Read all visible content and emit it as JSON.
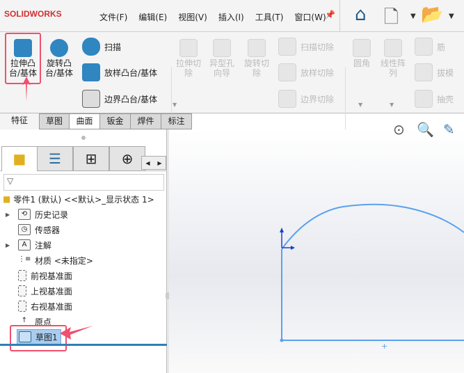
{
  "app": {
    "logo": "SOLIDWORKS"
  },
  "menu": [
    "文件(F)",
    "编辑(E)",
    "视图(V)",
    "插入(I)",
    "工具(T)",
    "窗口(W)"
  ],
  "ribbon": {
    "extrude_boss": "拉伸凸\n台/基体",
    "revolve_boss": "旋转凸\n台/基体",
    "sweep": "扫描",
    "loft": "放样凸台/基体",
    "boundary": "边界凸台/基体",
    "extrude_cut": "拉伸切\n除",
    "hole_wizard": "异型孔\n向导",
    "revolve_cut": "旋转切\n除",
    "sweep_cut": "扫描切除",
    "loft_cut": "放样切除",
    "boundary_cut": "边界切除",
    "fillet": "圆角",
    "linear_pattern": "线性阵\n列",
    "rib": "筋",
    "draft": "拔模",
    "shell": "抽壳"
  },
  "tabs": [
    "特征",
    "草图",
    "曲面",
    "钣金",
    "焊件",
    "标注"
  ],
  "tree": {
    "root": "零件1 (默认) <<默认>_显示状态 1>",
    "items": [
      "历史记录",
      "传感器",
      "注解",
      "材质 <未指定>",
      "前视基准面",
      "上视基准面",
      "右视基准面",
      "原点",
      "草图1"
    ]
  },
  "colors": {
    "accent": "#f0506e",
    "sketch": "#5aa0f0",
    "selected": "#a9cdef"
  }
}
